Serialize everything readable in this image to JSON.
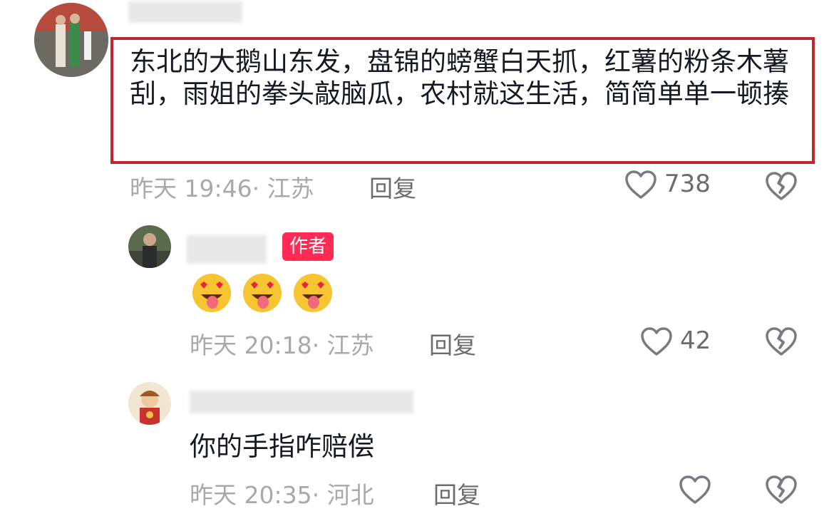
{
  "comments": [
    {
      "text": "东北的大鹅山东发，盘锦的螃蟹白天抓，红薯的粉条木薯刮，雨姐的拳头敲脑瓜，农村就这生活，简简单单一顿揍",
      "time_location": "昨天 19:46· 江苏",
      "reply_label": "回复",
      "likes": "738"
    },
    {
      "author_tag": "作者",
      "text_emoji": [
        "star-eyes-tongue-emoji",
        "star-eyes-tongue-emoji",
        "star-eyes-tongue-emoji"
      ],
      "time_location": "昨天 20:18· 江苏",
      "reply_label": "回复",
      "likes": "42"
    },
    {
      "text": "你的手指咋赔偿",
      "time_location": "昨天 20:35· 河北",
      "reply_label": "回复",
      "likes": ""
    }
  ],
  "icons": {
    "like": "heart-outline-icon",
    "dislike": "broken-heart-icon"
  },
  "colors": {
    "highlight_border": "#c0262d",
    "author_tag": "#fe2c55",
    "meta_text": "#a8a8ad"
  }
}
